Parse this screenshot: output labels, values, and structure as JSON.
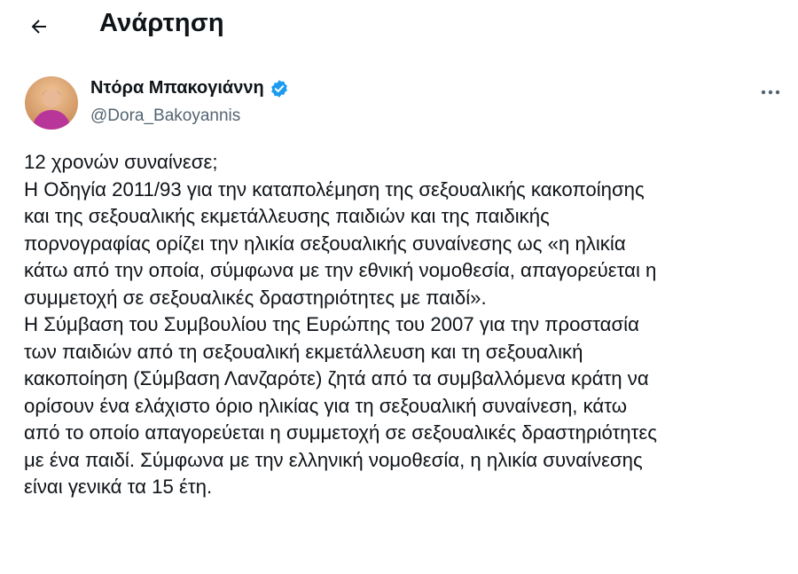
{
  "header": {
    "back_icon": "arrow-left-icon",
    "title": "Ανάρτηση"
  },
  "author": {
    "display_name": "Ντόρα Μπακογιάννη",
    "handle": "@Dora_Bakoyannis",
    "verified_icon": "verified-badge-icon",
    "verified_color": "#1d9bf0",
    "more_icon": "more-horizontal-icon"
  },
  "tweet": {
    "lines": [
      "12 χρονών συναίνεσε;",
      "Η Οδηγία 2011/93 για την καταπολέμηση της σεξουαλικής κακοποίησης",
      "και της σεξουαλικής εκμετάλλευσης παιδιών και της παιδικής",
      "πορνογραφίας ορίζει την ηλικία σεξουαλικής συναίνεσης ως «η ηλικία",
      "κάτω από την οποία, σύμφωνα με την εθνική νομοθεσία, απαγορεύεται η",
      "συμμετοχή σε σεξουαλικές δραστηριότητες με παιδί».",
      "Η Σύμβαση του Συμβουλίου της Ευρώπης του 2007 για την προστασία",
      "των παιδιών από τη σεξουαλική εκμετάλλευση και τη σεξουαλική",
      "κακοποίηση (Σύμβαση Λανζαρότε) ζητά από τα συμβαλλόμενα κράτη να",
      "ορίσουν ένα ελάχιστο όριο ηλικίας για τη σεξουαλική συναίνεση, κάτω",
      "από το οποίο απαγορεύεται η συμμετοχή σε σεξουαλικές δραστηριότητες",
      "με ένα παιδί. Σύμφωνα με την ελληνική νομοθεσία, η ηλικία συναίνεσης",
      "είναι γενικά τα 15 έτη."
    ]
  }
}
